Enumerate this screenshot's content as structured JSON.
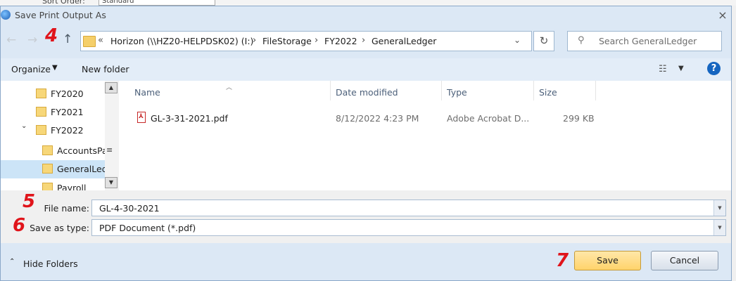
{
  "background": {
    "label": "Sort Order:",
    "value": "Standard"
  },
  "dialog": {
    "title": "Save Print Output As",
    "close_glyph": "×"
  },
  "nav": {
    "back_glyph": "←",
    "forward_glyph": "→",
    "up_glyph": "↑",
    "breadcrumb_chevron": "«",
    "breadcrumbs": [
      "Horizon (\\\\HZ20-HELPDSK02) (I:)",
      "FileStorage",
      "FY2022",
      "GeneralLedger"
    ],
    "separator": "›",
    "dropdown_glyph": "⌄",
    "refresh_glyph": "↻",
    "search_placeholder": "Search GeneralLedger",
    "search_glyph": "⚲"
  },
  "toolbar": {
    "organize_label": "Organize",
    "caret": "▼",
    "new_folder_label": "New folder",
    "view_glyph": "☷",
    "help_glyph": "?"
  },
  "tree": {
    "items": [
      {
        "label": "FY2020"
      },
      {
        "label": "FY2021"
      },
      {
        "label": "FY2022"
      },
      {
        "label": "AccountsPa"
      },
      {
        "label": "GeneralLedg"
      },
      {
        "label": "Payroll"
      }
    ],
    "expander_glyph": "⌄",
    "scroll_up": "▲",
    "scroll_down": "▼",
    "scroll_grip": "≡"
  },
  "file_list": {
    "columns": [
      "Name",
      "Date modified",
      "Type",
      "Size"
    ],
    "sort_glyph": "︿",
    "rows": [
      {
        "name": "GL-3-31-2021.pdf",
        "date": "8/12/2022 4:23 PM",
        "type": "Adobe Acrobat D...",
        "size": "299 KB"
      }
    ],
    "pdf_glyph": "⅄"
  },
  "form": {
    "file_name_label": "File name:",
    "file_name_value": "GL-4-30-2021",
    "save_type_label": "Save as type:",
    "save_type_value": "PDF Document (*.pdf)",
    "drop_glyph": "▼"
  },
  "footer": {
    "hide_folders_label": "Hide Folders",
    "hide_caret": "⌃",
    "save_label": "Save",
    "cancel_label": "Cancel"
  },
  "annotations": [
    "4",
    "5",
    "6",
    "7"
  ],
  "colors": {
    "annotation": "#e0141b",
    "save_button": "#ffd36b",
    "selection": "#cce4f7"
  }
}
